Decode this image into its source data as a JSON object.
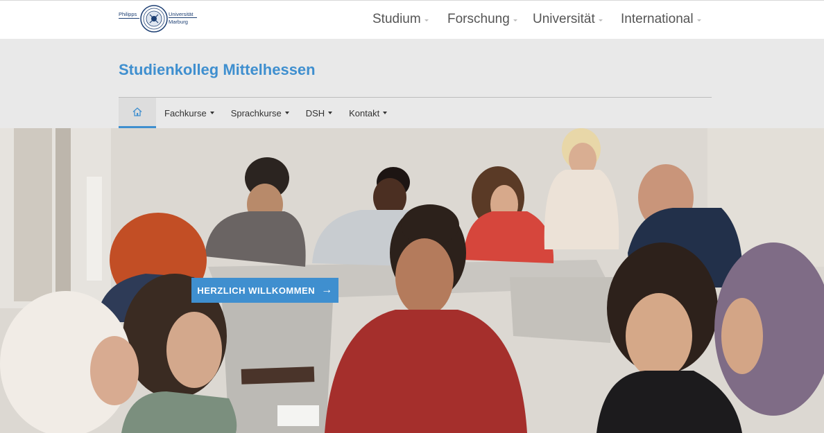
{
  "logo": {
    "left_text": "Philipps",
    "right_text_line1": "Universität",
    "right_text_line2": "Marburg"
  },
  "main_nav": [
    {
      "label": "Studium"
    },
    {
      "label": "Forschung"
    },
    {
      "label": "Universität"
    },
    {
      "label": "International"
    }
  ],
  "site_title": "Studienkolleg Mittelhessen",
  "sub_nav": {
    "home_icon": "home-icon",
    "items": [
      {
        "label": "Fachkurse"
      },
      {
        "label": "Sprachkurse"
      },
      {
        "label": "DSH"
      },
      {
        "label": "Kontakt"
      }
    ]
  },
  "hero": {
    "cta_label": "HERZLICH WILLKOMMEN",
    "cta_icon": "arrow-right-icon"
  },
  "colors": {
    "accent": "#3f8fcf",
    "header_band": "#e9e9e9",
    "nav_text": "#555555"
  }
}
